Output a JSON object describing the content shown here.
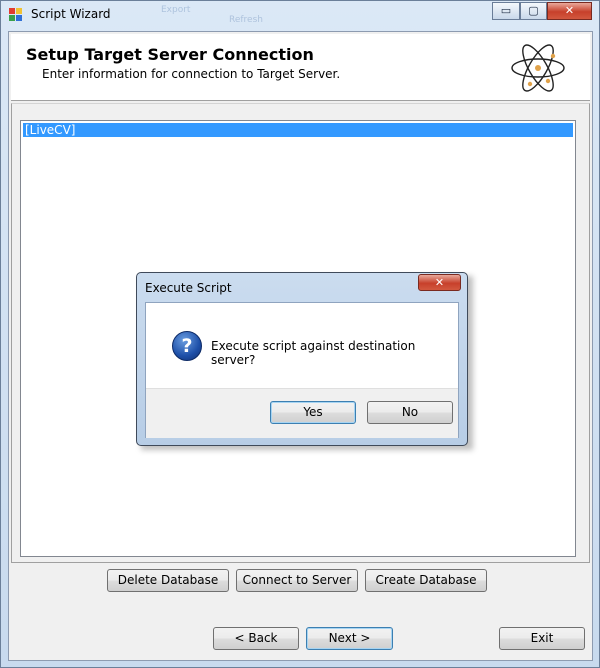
{
  "window": {
    "title": "Script Wizard",
    "ghost_left": "Export",
    "ghost_right": "Refresh"
  },
  "controls": {
    "minimize": "▭",
    "maximize": "▢",
    "close": "✕"
  },
  "header": {
    "title": "Setup Target Server Connection",
    "subtitle": "Enter information for connection to Target Server.",
    "logo_icon": "atom-icon"
  },
  "server_list": {
    "items": [
      "[LiveCV]"
    ],
    "selected_index": 0
  },
  "actions": {
    "delete_database": "Delete Database",
    "connect_to_server": "Connect to Server",
    "create_database": "Create Database"
  },
  "nav": {
    "back": "< Back",
    "next": "Next >",
    "exit": "Exit"
  },
  "dialog": {
    "title": "Execute Script",
    "close": "✕",
    "icon": "question-icon",
    "message": "Execute script against destination server?",
    "yes": "Yes",
    "no": "No"
  },
  "colors": {
    "selection": "#3399ff",
    "close_red": "#c7402b",
    "window_frame": "#c8daee"
  }
}
